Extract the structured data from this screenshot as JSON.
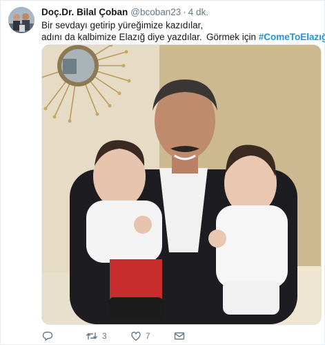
{
  "tweet": {
    "author_name": "Doç.Dr. Bilal Çoban",
    "handle": "@bcoban23",
    "separator": "·",
    "time": "4 dk.",
    "text_line1": "Bir sevdayı getirip yüreğimize kazıdılar,",
    "text_line2": "adını da kalbimize Elazığ diye yazdılar.",
    "text_tail": "Görmek için",
    "hashtag": "#ComeToElazığ"
  },
  "actions": {
    "reply_icon": "reply-icon",
    "retweet_icon": "retweet-icon",
    "retweet_count": "3",
    "like_icon": "heart-icon",
    "like_count": "7",
    "dm_icon": "envelope-icon"
  },
  "colors": {
    "text": "#14171a",
    "secondary": "#657786",
    "link": "#1b95e0",
    "border": "#e6ecf0"
  }
}
